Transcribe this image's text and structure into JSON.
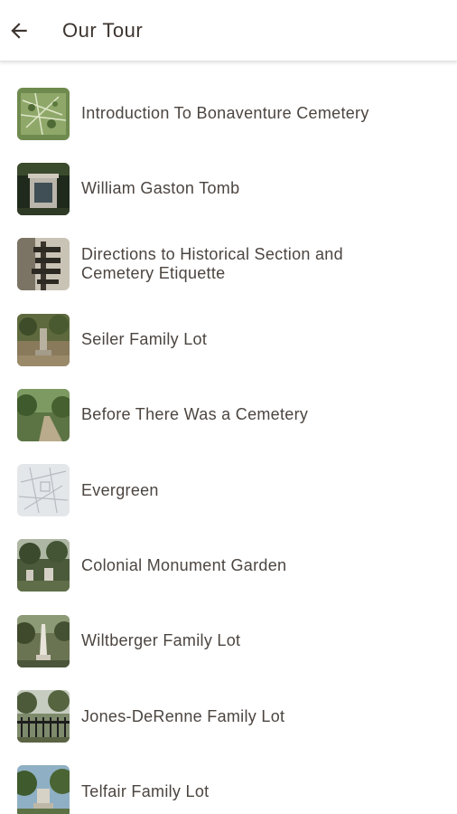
{
  "header": {
    "title": "Our Tour",
    "back_icon": "arrow-back-icon"
  },
  "tour": {
    "items": [
      {
        "label": "Introduction To Bonaventure Cemetery",
        "thumb": "map-thumbnail"
      },
      {
        "label": "William Gaston Tomb",
        "thumb": "tomb-thumbnail"
      },
      {
        "label": "Directions to Historical Section and Cemetery Etiquette",
        "thumb": "signpost-thumbnail"
      },
      {
        "label": "Seiler Family Lot",
        "thumb": "monument-thumbnail"
      },
      {
        "label": "Before There Was a Cemetery",
        "thumb": "path-thumbnail"
      },
      {
        "label": "Evergreen",
        "thumb": "sketch-map-thumbnail"
      },
      {
        "label": "Colonial Monument Garden",
        "thumb": "garden-thumbnail"
      },
      {
        "label": "Wiltberger Family Lot",
        "thumb": "obelisk-thumbnail"
      },
      {
        "label": "Jones-DeRenne Family Lot",
        "thumb": "fenced-lot-thumbnail"
      },
      {
        "label": "Telfair Family Lot",
        "thumb": "telfair-thumbnail"
      }
    ]
  },
  "colors": {
    "text": "#4c4540",
    "title": "#3d3530",
    "divider": "#e2e2e2"
  }
}
